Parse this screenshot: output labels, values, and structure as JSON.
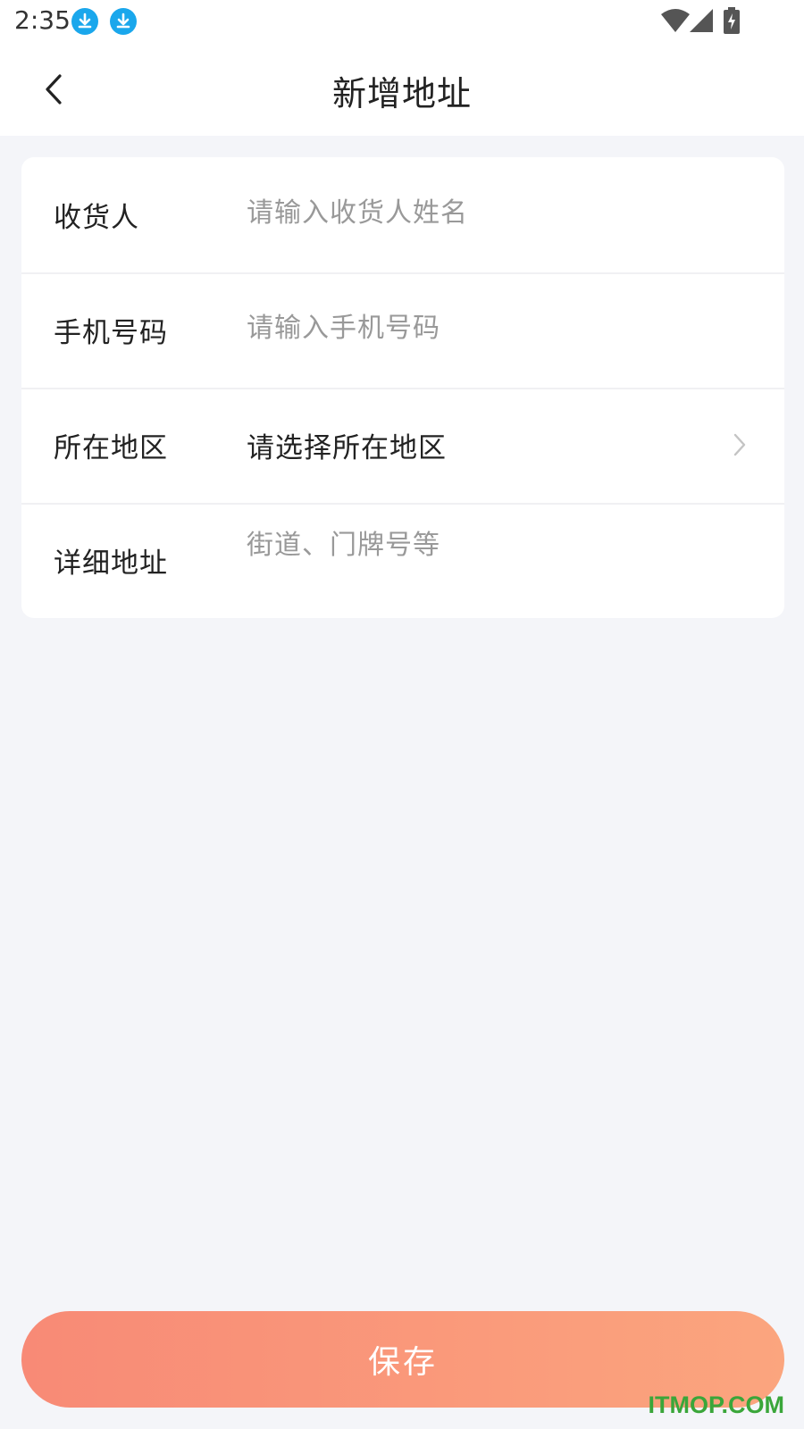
{
  "status_bar": {
    "time": "2:35",
    "icons": [
      "download-notification-icon",
      "download-notification-icon",
      "wifi-icon",
      "cell-signal-icon",
      "battery-charging-icon"
    ]
  },
  "header": {
    "title": "新增地址",
    "back_icon": "chevron-left-icon"
  },
  "form": {
    "consignee": {
      "label": "收货人",
      "placeholder": "请输入收货人姓名",
      "value": ""
    },
    "phone": {
      "label": "手机号码",
      "placeholder": "请输入手机号码",
      "value": ""
    },
    "region": {
      "label": "所在地区",
      "value": "请选择所在地区",
      "icon": "chevron-right-icon"
    },
    "address": {
      "label": "详细地址",
      "placeholder": "街道、门牌号等",
      "value": ""
    }
  },
  "save_button": {
    "label": "保存"
  },
  "watermark": "ITMOP.COM",
  "colors": {
    "accent_start": "#f88a76",
    "accent_end": "#fba57e",
    "download_icon": "#1aa7ec",
    "background": "#f4f5f9"
  }
}
